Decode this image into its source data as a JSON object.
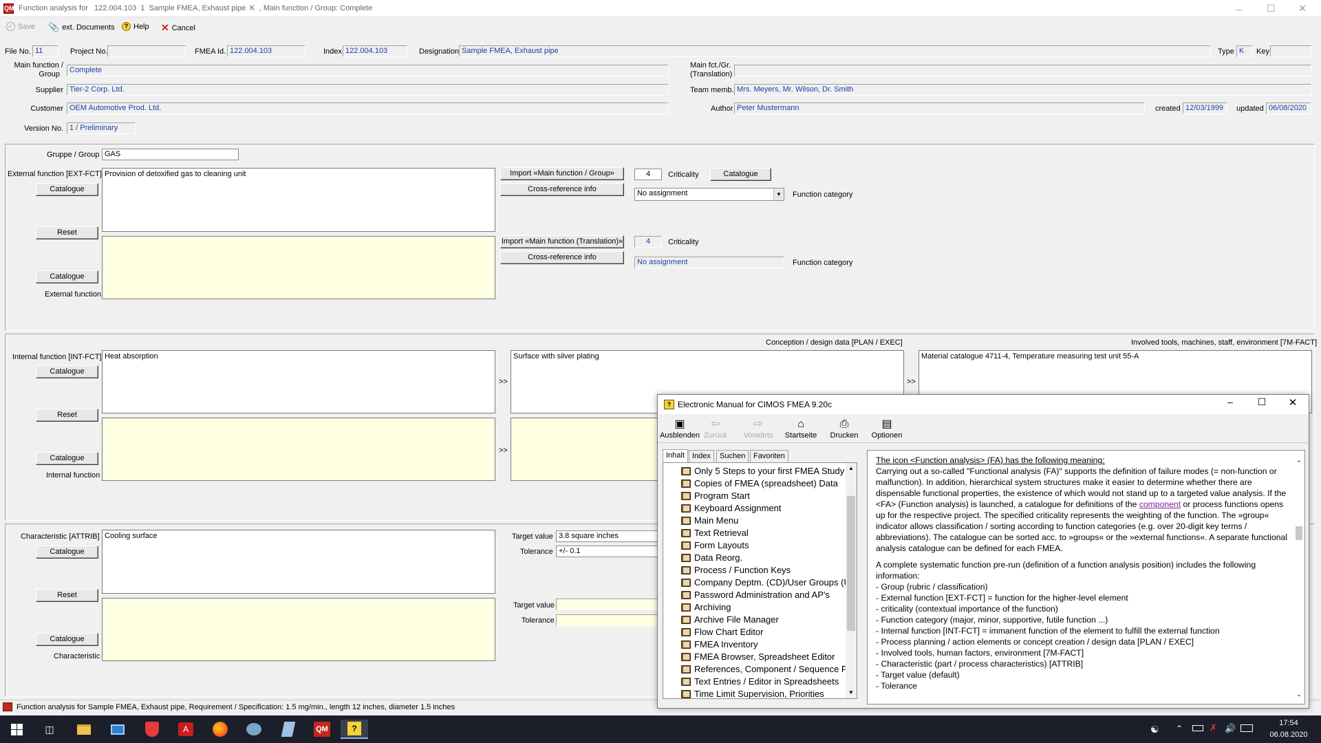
{
  "window": {
    "title": "Function analysis for   122.004.103  1  Sample FMEA, Exhaust pipe  K  , Main function / Group: Complete"
  },
  "toolbar": {
    "save": "Save",
    "ext_documents": "ext. Documents",
    "help": "Help",
    "cancel": "Cancel"
  },
  "header": {
    "file_no_label": "File No.",
    "file_no": "11",
    "project_no_label": "Project No.",
    "project_no": "",
    "fmea_id_label": "FMEA Id.",
    "fmea_id": "122.004.103",
    "index_label": "Index",
    "index": "122.004.103",
    "designation_label": "Designation",
    "designation": "Sample FMEA, Exhaust pipe",
    "type_label": "Type",
    "type": "K",
    "key_label": "Key",
    "key": "",
    "main_function_label_1": "Main function /",
    "main_function_label_2": "Group",
    "main_function": "Complete",
    "main_fct_translation_label_1": "Main fct./Gr.",
    "main_fct_translation_label_2": "(Translation)",
    "main_fct_translation": "",
    "supplier_label": "Supplier",
    "supplier": "Tier-2 Corp. Ltd.",
    "team_label": "Team memb.",
    "team": "Mrs. Meyers, Mr. Wilson, Dr. Smith",
    "customer_label": "Customer",
    "customer": "OEM Automotive Prod. Ltd.",
    "author_label": "Author",
    "author": "Peter Mustermann",
    "created_label": "created",
    "created": "12/03/1999",
    "updated_label": "updated",
    "updated": "06/08/2020",
    "version_label": "Version No.",
    "version": "1 / Preliminary"
  },
  "ext_section": {
    "group_label": "Gruppe / Group",
    "group": "GAS",
    "ext_fct_label": "External function [EXT-FCT]",
    "ext_fct": "Provision of detoxified gas to cleaning unit",
    "catalogue": "Catalogue",
    "reset": "Reset",
    "catalogue2": "Catalogue",
    "ext_function_label": "External function",
    "import_main": "Import «Main function / Group»",
    "crossref": "Cross-reference info",
    "import_translation": "Import «Main function (Translation)»",
    "crossref2": "Cross-reference info",
    "criticality_value": "4",
    "criticality_label": "Criticality",
    "criticality_value2": "4",
    "criticality_label2": "Criticality",
    "catalogue_btn": "Catalogue",
    "category_select": "No assignment",
    "category_label": "Function category",
    "category_value2": "No assignment",
    "category_label2": "Function category"
  },
  "int_section": {
    "int_fct_label": "Internal function [INT-FCT]",
    "int_fct": "Heat absorption",
    "conception_label": "Conception / design data [PLAN / EXEC]",
    "conception": "Surface with silver plating",
    "tools_label": "Involved tools, machines, staff, environment [7M-FACT]",
    "tools": "Material catalogue 4711-4, Temperature measuring test unit 55-A",
    "catalogue": "Catalogue",
    "reset": "Reset",
    "catalogue2": "Catalogue",
    "int_function_label": "Internal function",
    "arrow": ">>"
  },
  "attr_section": {
    "attr_label": "Characteristic [ATTRIB]",
    "attr": "Cooling surface",
    "catalogue": "Catalogue",
    "reset": "Reset",
    "catalogue2": "Catalogue",
    "characteristic_label": "Characteristic",
    "target_label": "Target value",
    "target": "3.8 square inches",
    "tolerance_label": "Tolerance",
    "tolerance": "+/- 0.1",
    "target_label2": "Target value",
    "tolerance_label2": "Tolerance"
  },
  "status": {
    "text": "Function analysis for Sample FMEA, Exhaust pipe, Requirement / Specification: 1.5 mg/min., length 12 inches, diameter 1.5 inches"
  },
  "help": {
    "title": "Electronic Manual for CIMOS FMEA 9.20c",
    "tools": [
      "Ausblenden",
      "Zurück",
      "Vorwärts",
      "Startseite",
      "Drucken",
      "Optionen"
    ],
    "tabs": [
      "Inhalt",
      "Index",
      "Suchen",
      "Favoriten"
    ],
    "tree": [
      "Only 5 Steps to your first FMEA Study",
      "Copies of FMEA (spreadsheet) Data",
      "Program Start",
      "Keyboard Assignment",
      "Main Menu",
      "Text Retrieval",
      "Form Layouts",
      "Data Reorg.",
      "Process / Function Keys",
      "Company Deptm. (CD)/User Groups (UG)",
      "Password Administration and AP's",
      "Archiving",
      "Archive File Manager",
      "Flow Chart Editor",
      "FMEA Inventory",
      "FMEA Browser, Spreadsheet Editor",
      "References, Component / Sequence FMEAs",
      "Text Entries / Editor in Spreadsheets",
      "Time Limit Supervision, Priorities"
    ],
    "doc_heading": "The icon <Function analysis> (FA) has the following meaning:",
    "doc_p1a": "Carrying out a so-called \"Functional analysis (FA)\" supports the definition of failure modes (= non-function or malfunction). In addition, hierarchical system structures make it easier to determine whether there are dispensable functional properties, the existence of which would not stand up to a targeted value analysis. If the <FA> (Function analysis) is launched, a catalogue for definitions of the ",
    "doc_link": "component",
    "doc_p1b": " or process functions opens up for the respective project. The specified criticality represents the weighting of the function. The »group« indicator allows classification / sorting according to function categories (e.g. over 20-digit key terms / abbreviations). The catalogue can be sorted acc. to »groups« or the »external functions«. A separate functional analysis catalogue can be defined for each FMEA.",
    "doc_p2": "A complete systematic function pre-run (definition of a function analysis position) includes the following information:",
    "doc_list": [
      "- Group (rubric / classification)",
      "- External function [EXT-FCT] = function for the higher-level element",
      "- criticality (contextual importance of the function)",
      "- Function category (major, minor, supportive, futile function ...)",
      "- Internal function [INT-FCT] = immanent function of the element to fulfill the external function",
      "- Process planning / action elements or concept creation / design data [PLAN / EXEC]",
      "- Involved tools, human factors, environment [7M-FACT]",
      "- Characteristic (part / process characteristics) [ATTRIB]",
      "- Target value (default)",
      "- Tolerance"
    ]
  },
  "taskbar": {
    "time": "17:54",
    "date": "06.08.2020"
  }
}
